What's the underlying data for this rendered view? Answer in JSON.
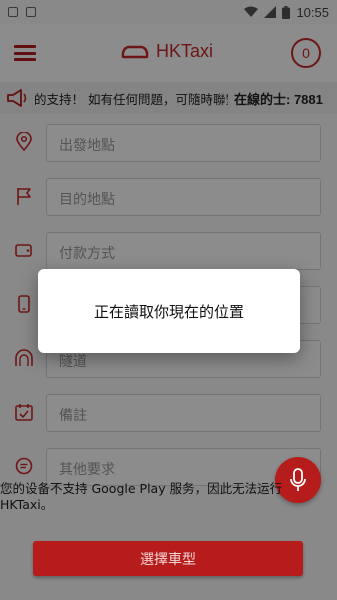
{
  "status_bar": {
    "time": "10:55",
    "icons": [
      "image-icon",
      "text-icon",
      "wifi-icon",
      "signal-icon",
      "battery-icon"
    ]
  },
  "app_bar": {
    "title": "HKTaxi",
    "badge_count": "0"
  },
  "ticker": {
    "message": "的支持！ 如有任何問題，可隨時聯繫我們",
    "online_drivers": "在線的士: 7881"
  },
  "form": {
    "pickup_placeholder": "出發地點",
    "destination_placeholder": "目的地點",
    "payment_placeholder": "付款方式",
    "phone_placeholder": "",
    "tunnel_placeholder": "隧道",
    "remarks_placeholder": "備註",
    "other_placeholder": "其他要求"
  },
  "toast": {
    "text": "您的设备不支持 Google Play 服务，因此无法运行 HKTaxi。"
  },
  "buttons": {
    "select_car_type": "選擇車型"
  },
  "dialog": {
    "message": "正在讀取你現在的位置"
  },
  "colors": {
    "brand": "#c62828",
    "overlay": "rgba(0,0,0,0.45)"
  }
}
